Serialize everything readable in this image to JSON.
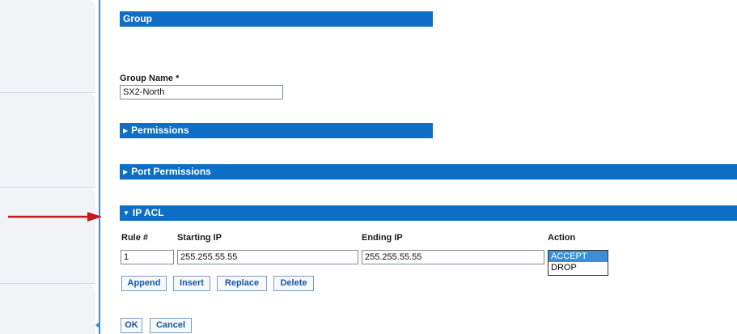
{
  "sections": {
    "group": {
      "title": "Group"
    },
    "permissions": {
      "title": "Permissions",
      "expanded": false
    },
    "port_permissions": {
      "title": "Port Permissions",
      "expanded": false
    },
    "ip_acl": {
      "title": "IP ACL",
      "expanded": true
    }
  },
  "group_name": {
    "label": "Group Name *",
    "value": "SX2-North"
  },
  "icons": {
    "collapsed": "▶",
    "expanded": "▼"
  },
  "acl": {
    "columns": {
      "rule": "Rule #",
      "starting_ip": "Starting IP",
      "ending_ip": "Ending IP",
      "action": "Action"
    },
    "row": {
      "rule": "1",
      "starting_ip": "255.255.55.55",
      "ending_ip": "255.255.55.55"
    },
    "action_options": [
      "ACCEPT",
      "DROP"
    ],
    "selected_action": "ACCEPT",
    "buttons": {
      "append": "Append",
      "insert": "Insert",
      "replace": "Replace",
      "delete": "Delete"
    }
  },
  "footer": {
    "ok": "OK",
    "cancel": "Cancel"
  },
  "colors": {
    "section_bar": "#0f6fc6",
    "divider": "#3f86d0",
    "arrow": "#c0181e",
    "selection": "#3c8edb",
    "button_text": "#1757a6"
  }
}
